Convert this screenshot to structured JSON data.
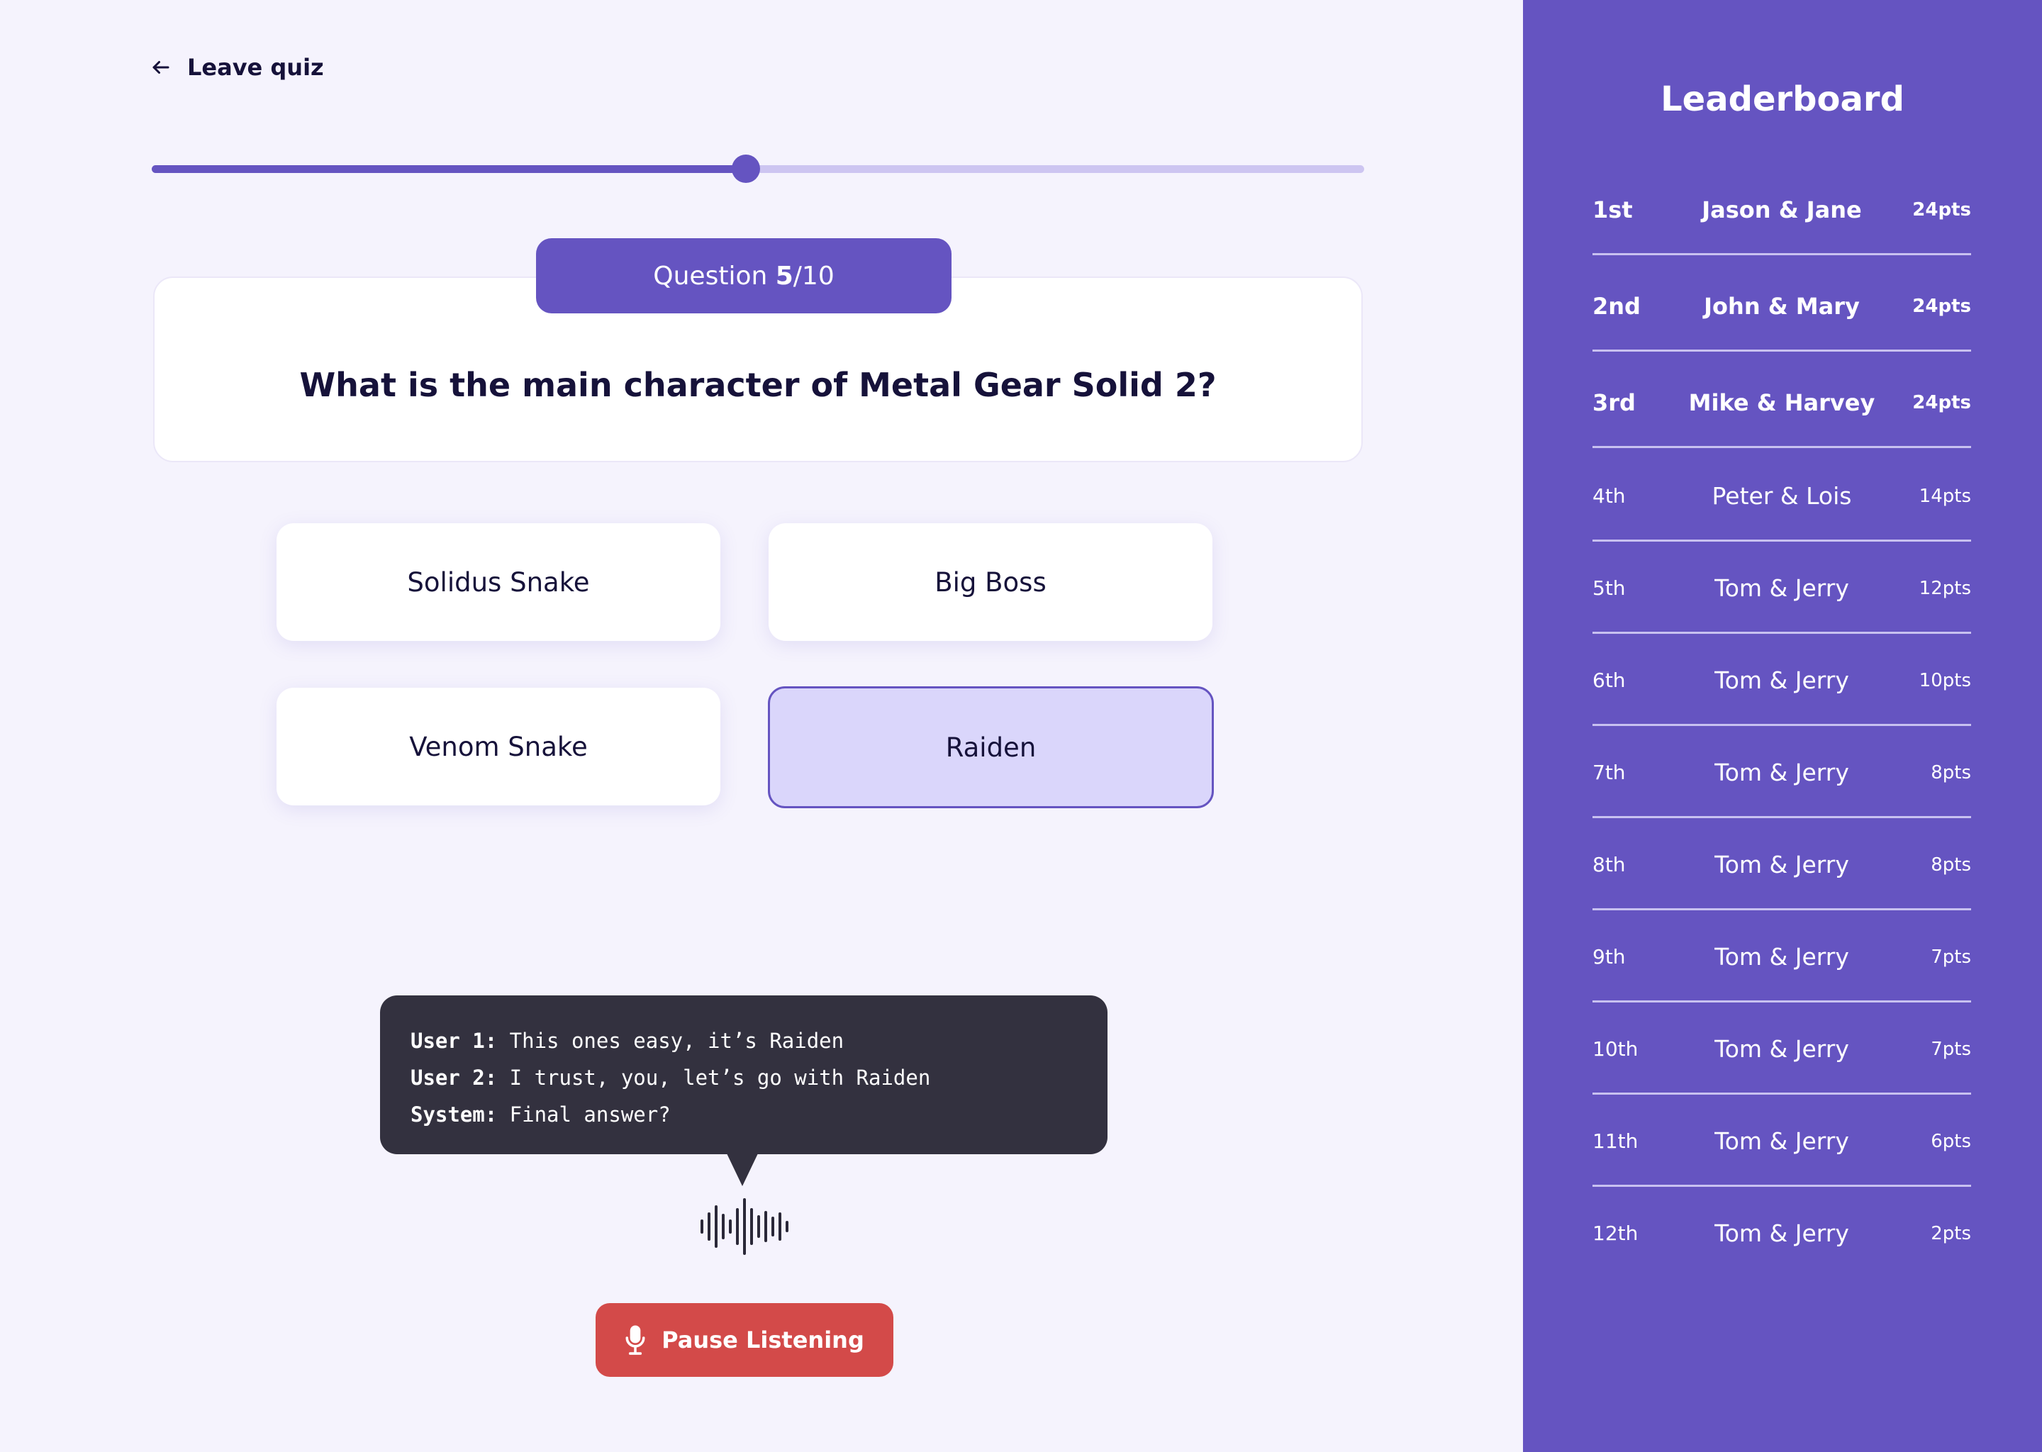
{
  "nav": {
    "leave_label": "Leave quiz",
    "leave_icon": "arrow-left-icon"
  },
  "progress": {
    "current": 5,
    "total": 10,
    "fraction": 0.49
  },
  "question": {
    "badge_prefix": "Question ",
    "number": "5",
    "total_suffix": "/10",
    "text": "What is the main character of Metal Gear Solid 2?"
  },
  "answers": [
    {
      "label": "Solidus Snake",
      "selected": false
    },
    {
      "label": "Big Boss",
      "selected": false
    },
    {
      "label": "Venom Snake",
      "selected": false
    },
    {
      "label": "Raiden",
      "selected": true
    }
  ],
  "transcript": [
    {
      "speaker": "User 1:",
      "text": " This ones easy, it’s Raiden"
    },
    {
      "speaker": "User 2:",
      "text": " I trust, you, let’s go with Raiden"
    },
    {
      "speaker": "System:",
      "text": " Final answer?"
    }
  ],
  "voice": {
    "waveform_icon": "waveform-icon",
    "pause_label": "Pause Listening",
    "mic_icon": "microphone-icon"
  },
  "leaderboard": {
    "title": "Leaderboard",
    "rows": [
      {
        "rank": "1st",
        "name": "Jason & Jane",
        "score": "24pts"
      },
      {
        "rank": "2nd",
        "name": "John & Mary",
        "score": "24pts"
      },
      {
        "rank": "3rd",
        "name": "Mike & Harvey",
        "score": "24pts"
      },
      {
        "rank": "4th",
        "name": "Peter & Lois",
        "score": "14pts"
      },
      {
        "rank": "5th",
        "name": "Tom & Jerry",
        "score": "12pts"
      },
      {
        "rank": "6th",
        "name": "Tom & Jerry",
        "score": "10pts"
      },
      {
        "rank": "7th",
        "name": "Tom & Jerry",
        "score": "8pts"
      },
      {
        "rank": "8th",
        "name": "Tom & Jerry",
        "score": "8pts"
      },
      {
        "rank": "9th",
        "name": "Tom & Jerry",
        "score": "7pts"
      },
      {
        "rank": "10th",
        "name": "Tom & Jerry",
        "score": "7pts"
      },
      {
        "rank": "11th",
        "name": "Tom & Jerry",
        "score": "6pts"
      },
      {
        "rank": "12th",
        "name": "Tom & Jerry",
        "score": "2pts"
      }
    ]
  },
  "colors": {
    "accent": "#6554c1",
    "page_bg": "#f5f3fd",
    "selected_answer_bg": "#dad6fb",
    "transcript_bg": "#33313f",
    "pause_button": "#d34a49",
    "text_dark": "#16123a"
  }
}
